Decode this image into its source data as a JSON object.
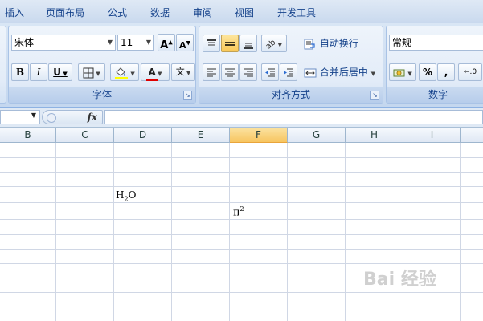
{
  "menu": {
    "tabs": [
      "插入",
      "页面布局",
      "公式",
      "数据",
      "审阅",
      "视图",
      "开发工具"
    ]
  },
  "ribbon": {
    "font_group": {
      "label": "字体",
      "font_name": "宋体",
      "font_size": "11",
      "bold": "B",
      "italic": "I",
      "underline": "U",
      "font_color_glyph": "A",
      "phonetic_glyph": "文"
    },
    "align_group": {
      "label": "对齐方式",
      "wrap_text": "自动换行",
      "merge_center": "合并后居中"
    },
    "number_group": {
      "label": "数字",
      "format": "常规",
      "percent": "%",
      "comma": ","
    }
  },
  "formula_bar": {
    "fx": "fx"
  },
  "grid": {
    "columns": [
      "B",
      "C",
      "D",
      "E",
      "F",
      "G",
      "H",
      "I"
    ],
    "selected_column": "F",
    "cells": {
      "d_base": "H",
      "d_sub": "2",
      "d_tail": "O",
      "f_base": "π",
      "f_sup": "2"
    }
  },
  "watermark": {
    "text": "Bai 经验"
  }
}
